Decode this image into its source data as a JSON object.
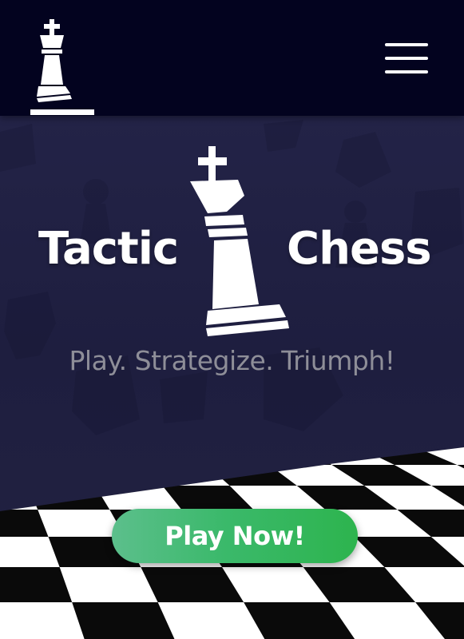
{
  "header": {
    "logo_icon": "chess-king-icon",
    "menu_icon": "hamburger-menu-icon"
  },
  "hero": {
    "title_left": "Tactic",
    "title_right": "Chess",
    "title_icon": "chess-king-icon",
    "tagline": "Play. Strategize. Triumph!",
    "play_button_label": "Play Now!"
  },
  "colors": {
    "header_bg": "#03031f",
    "hero_bg": "#1e1e3f",
    "accent_green": "#3bb96b",
    "tagline_gray": "#8e8e98"
  }
}
